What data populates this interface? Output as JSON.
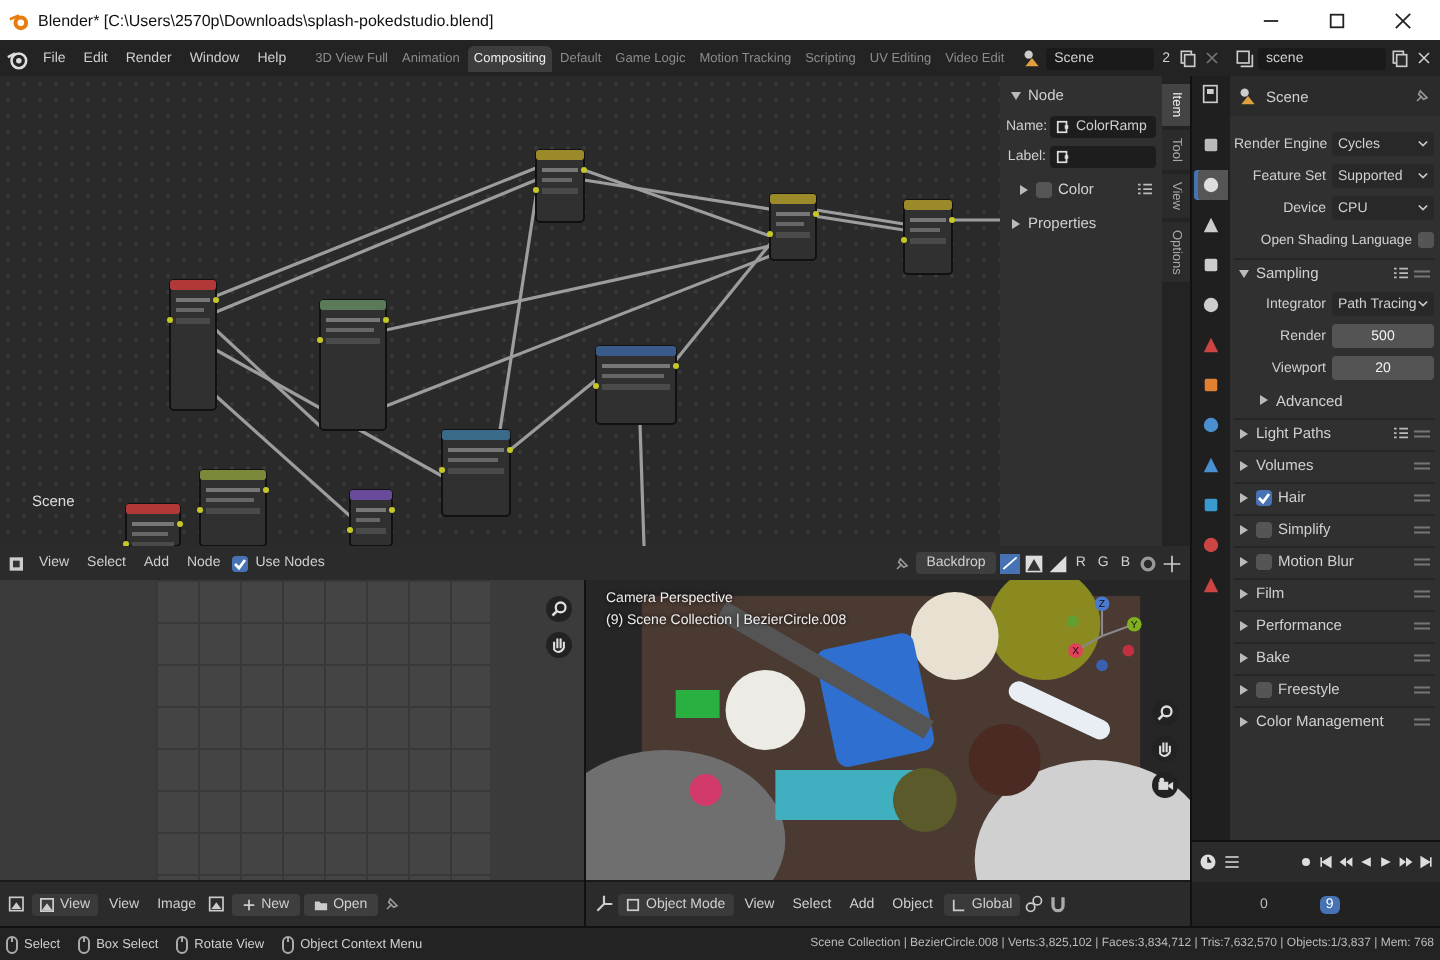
{
  "window": {
    "title": "Blender* [C:\\Users\\2570p\\Downloads\\splash-pokedstudio.blend]"
  },
  "menu": [
    "File",
    "Edit",
    "Render",
    "Window",
    "Help"
  ],
  "workspaces": [
    {
      "label": "3D View Full",
      "selected": false
    },
    {
      "label": "Animation",
      "selected": false
    },
    {
      "label": "Compositing",
      "selected": true
    },
    {
      "label": "Default",
      "selected": false
    },
    {
      "label": "Game Logic",
      "selected": false
    },
    {
      "label": "Motion Tracking",
      "selected": false
    },
    {
      "label": "Scripting",
      "selected": false
    },
    {
      "label": "UV Editing",
      "selected": false
    },
    {
      "label": "Video Edit",
      "selected": false
    }
  ],
  "scene": {
    "name": "Scene",
    "users": "2"
  },
  "view_layer": {
    "name": "scene"
  },
  "node_editor": {
    "label": "Scene",
    "menus": [
      "View",
      "Select",
      "Add",
      "Node"
    ],
    "use_nodes": {
      "label": "Use Nodes",
      "checked": true
    },
    "backdrop": "Backdrop",
    "channels": [
      "R",
      "G",
      "B"
    ]
  },
  "node_sidebar": {
    "tabs": [
      {
        "label": "Item",
        "selected": true
      },
      {
        "label": "Tool",
        "selected": false
      },
      {
        "label": "View",
        "selected": false
      },
      {
        "label": "Options",
        "selected": false
      }
    ],
    "panel": {
      "label": "Node",
      "expanded": true
    },
    "fields": [
      {
        "label": "Name:",
        "value": "ColorRamp"
      },
      {
        "label": "Label:"
      }
    ],
    "color": {
      "label": "Color",
      "checked": false,
      "expanded": false
    },
    "properties": {
      "label": "Properties",
      "expanded": false
    }
  },
  "properties": {
    "context": "Scene",
    "tabs": [
      {
        "selected": false
      },
      {
        "selected": true
      },
      {
        "selected": false
      },
      {
        "selected": false
      },
      {
        "selected": false
      },
      {
        "selected": false
      },
      {
        "selected": false
      },
      {
        "selected": false
      },
      {
        "selected": false
      },
      {
        "selected": false
      },
      {
        "selected": false
      },
      {
        "selected": false
      }
    ],
    "rows": [
      {
        "kind": "dropdown",
        "label": "Render Engine",
        "value": "Cycles"
      },
      {
        "kind": "dropdown",
        "label": "Feature Set",
        "value": "Supported"
      },
      {
        "kind": "dropdown",
        "label": "Device",
        "value": "CPU"
      },
      {
        "kind": "toggle",
        "label": "Open Shading Language",
        "checked": false
      },
      {
        "kind": "panel",
        "label": "Sampling",
        "expanded": true,
        "presets": true
      },
      {
        "kind": "dropdown",
        "label": "Integrator",
        "value": "Path Tracing"
      },
      {
        "kind": "number",
        "label": "Render",
        "value": "500"
      },
      {
        "kind": "number",
        "label": "Viewport",
        "value": "20"
      },
      {
        "kind": "subpanel",
        "label": "Advanced",
        "expanded": false
      },
      {
        "kind": "panel",
        "label": "Light Paths",
        "expanded": false,
        "presets": true
      },
      {
        "kind": "panel",
        "label": "Volumes",
        "expanded": false
      },
      {
        "kind": "checkpanel",
        "label": "Hair",
        "expanded": false,
        "checked": true
      },
      {
        "kind": "checkpanel",
        "label": "Simplify",
        "expanded": false,
        "checked": false
      },
      {
        "kind": "checkpanel",
        "label": "Motion Blur",
        "expanded": false,
        "checked": false
      },
      {
        "kind": "panel",
        "label": "Film",
        "expanded": false
      },
      {
        "kind": "panel",
        "label": "Performance",
        "expanded": false
      },
      {
        "kind": "panel",
        "label": "Bake",
        "expanded": false
      },
      {
        "kind": "checkpanel",
        "label": "Freestyle",
        "expanded": false,
        "checked": false
      },
      {
        "kind": "panel",
        "label": "Color Management",
        "expanded": false
      }
    ]
  },
  "timeline": {
    "start": "0",
    "current": "9"
  },
  "image_editor": {
    "view_mode": "View",
    "menus": [
      "View",
      "Image"
    ],
    "new": "New",
    "open": "Open"
  },
  "viewport": {
    "overlay": [
      "Camera Perspective",
      "(9) Scene Collection | BezierCircle.008"
    ],
    "axes": [
      "Z",
      "X",
      "Y"
    ],
    "mode": "Object Mode",
    "menus": [
      "View",
      "Select",
      "Add",
      "Object"
    ],
    "orientation": "Global"
  },
  "status_bar": {
    "hints": [
      "Select",
      "Box Select",
      "Rotate View",
      "Object Context Menu"
    ],
    "stats": "Scene Collection | BezierCircle.008 | Verts:3,825,102 | Faces:3,834,712 | Tris:7,632,570 | Objects:1/3,837 | Mem: 768"
  }
}
